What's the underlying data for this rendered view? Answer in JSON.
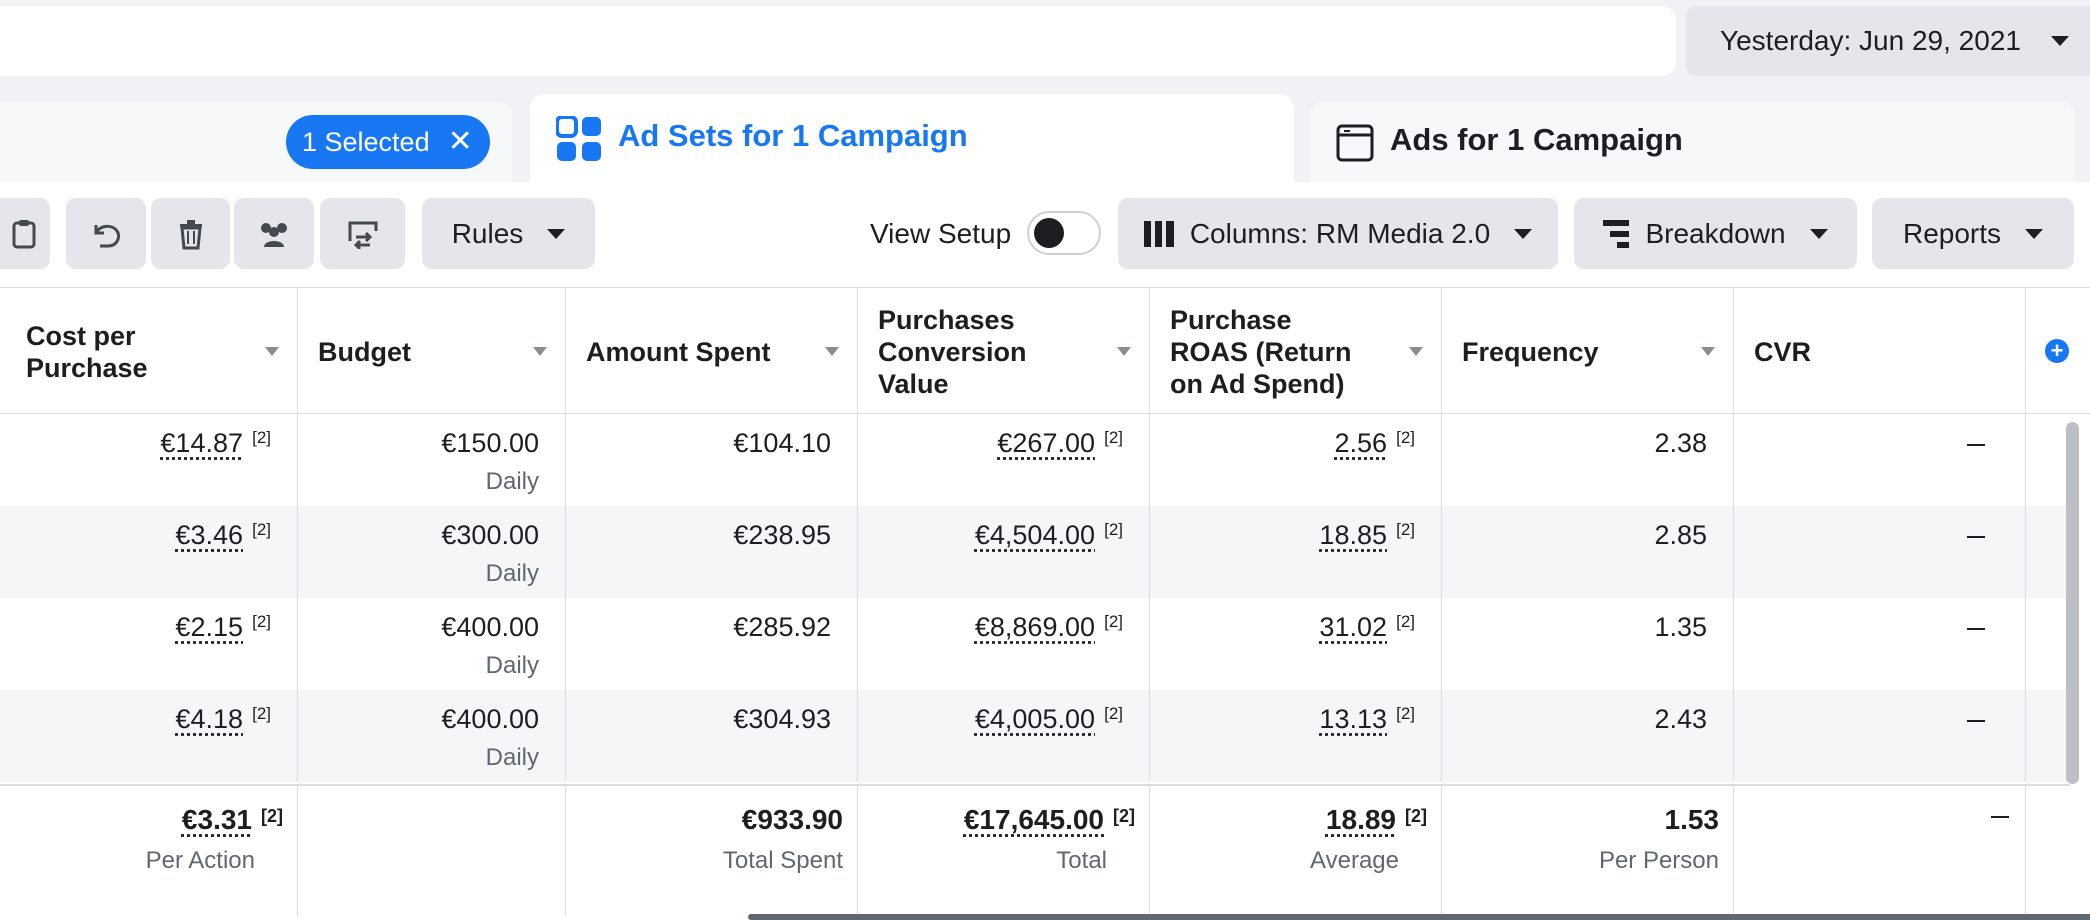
{
  "date_range": {
    "label": "Yesterday: Jun 29, 2021"
  },
  "tabs": {
    "selected_pill": "1 Selected",
    "active": "Ad Sets for 1 Campaign",
    "ads": "Ads for 1 Campaign"
  },
  "toolbar": {
    "rules": "Rules",
    "view_setup": "View Setup",
    "view_setup_on": false,
    "columns": "Columns: RM Media 2.0",
    "breakdown": "Breakdown",
    "reports": "Reports"
  },
  "columns": [
    "Cost per Purchase",
    "Budget",
    "Amount Spent",
    "Purchases Conversion Value",
    "Purchase ROAS (Return on Ad Spend)",
    "Frequency",
    "CVR"
  ],
  "footnote": "[2]",
  "rows": [
    {
      "cost_per_purchase": "€14.87",
      "budget": "€150.00",
      "budget_type": "Daily",
      "amount_spent": "€104.10",
      "conversion_value": "€267.00",
      "roas": "2.56",
      "frequency": "2.38",
      "cvr": "—"
    },
    {
      "cost_per_purchase": "€3.46",
      "budget": "€300.00",
      "budget_type": "Daily",
      "amount_spent": "€238.95",
      "conversion_value": "€4,504.00",
      "roas": "18.85",
      "frequency": "2.85",
      "cvr": "—"
    },
    {
      "cost_per_purchase": "€2.15",
      "budget": "€400.00",
      "budget_type": "Daily",
      "amount_spent": "€285.92",
      "conversion_value": "€8,869.00",
      "roas": "31.02",
      "frequency": "1.35",
      "cvr": "—"
    },
    {
      "cost_per_purchase": "€4.18",
      "budget": "€400.00",
      "budget_type": "Daily",
      "amount_spent": "€304.93",
      "conversion_value": "€4,005.00",
      "roas": "13.13",
      "frequency": "2.43",
      "cvr": "—"
    }
  ],
  "totals": {
    "cost_per_purchase": "€3.31",
    "cost_per_purchase_label": "Per Action",
    "amount_spent": "€933.90",
    "amount_spent_label": "Total Spent",
    "conversion_value": "€17,645.00",
    "conversion_value_label": "Total",
    "roas": "18.89",
    "roas_label": "Average",
    "frequency": "1.53",
    "frequency_label": "Per Person",
    "cvr": "—"
  },
  "colors": {
    "accent": "#1877f2",
    "button_bg": "#e4e6eb",
    "page_bg": "#f0f2f5"
  }
}
